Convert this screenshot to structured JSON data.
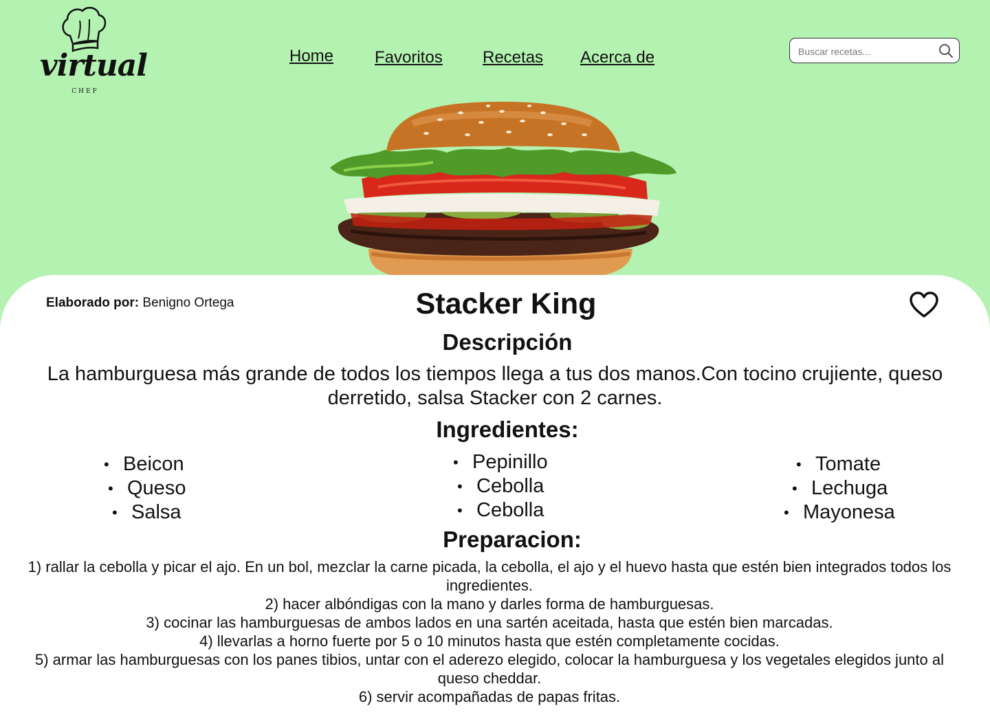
{
  "logo": {
    "word": "virtual",
    "sub": "CHEF"
  },
  "nav": {
    "home": "Home",
    "favorites": "Favoritos",
    "recipes": "Recetas",
    "about": "Acerca de"
  },
  "search": {
    "placeholder": "Buscar recetas...",
    "icon": "search-icon"
  },
  "recipe": {
    "author_label": "Elaborado por:",
    "author_name": "Benigno Ortega",
    "title": "Stacker King",
    "favorite_icon": "heart-icon",
    "description_heading": "Descripción",
    "description": "La hamburguesa más grande de todos los tiempos llega a tus dos manos.Con tocino crujiente, queso derretido, salsa Stacker con 2 carnes.",
    "ingredients_heading": "Ingredientes:",
    "ingredients": {
      "col1": [
        "Beicon",
        "Queso",
        "Salsa"
      ],
      "col2": [
        "Pepinillo",
        "Cebolla",
        "Cebolla"
      ],
      "col3": [
        "Tomate",
        "Lechuga",
        "Mayonesa"
      ]
    },
    "preparation_heading": "Preparacion:",
    "steps": [
      "1) rallar la cebolla y picar el ajo. En un bol, mezclar la carne picada, la cebolla, el ajo y el huevo hasta que estén bien integrados todos los ingredientes.",
      "2) hacer  albóndigas con la mano y darles forma de hamburguesas.",
      "3) cocinar las hamburguesas de ambos lados en una sartén aceitada, hasta que estén bien marcadas.",
      "4) llevarlas a horno fuerte por 5 o 10 minutos hasta que estén completamente cocidas.",
      "5) armar las hamburguesas con los panes tibios, untar con el aderezo elegido, colocar la hamburguesa y los vegetales elegidos junto al queso cheddar.",
      "6) servir acompañadas de papas fritas."
    ]
  },
  "colors": {
    "background": "#b4f2b1",
    "card": "#ffffff",
    "text": "#111111"
  }
}
